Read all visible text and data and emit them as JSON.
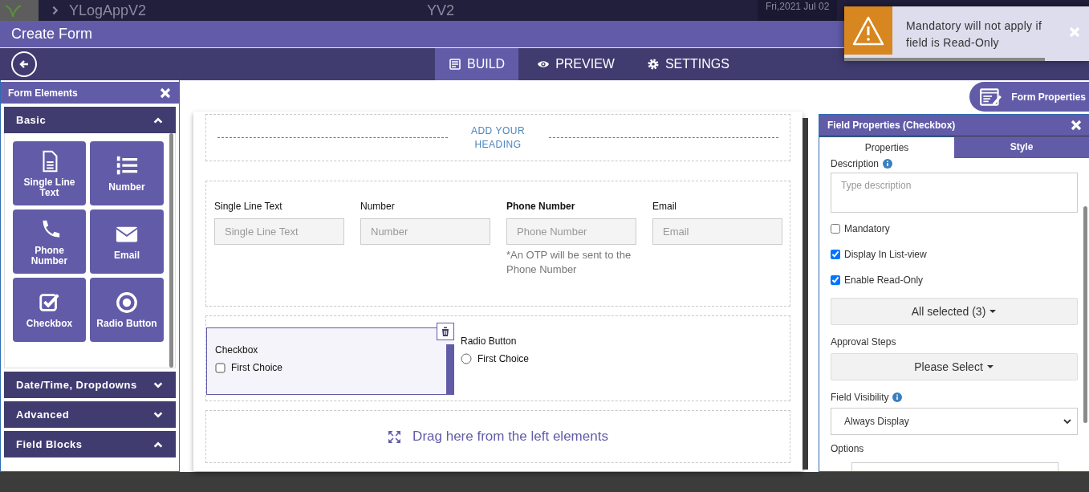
{
  "top_bar": {
    "app_name": "YLogAppV2",
    "center_label": "YV2",
    "date": "Fri,2021 Jul 02"
  },
  "page_title": "Create Form",
  "tabs": [
    {
      "label": "BUILD",
      "kind": "build",
      "selected": true
    },
    {
      "label": "PREVIEW",
      "kind": "preview",
      "selected": false
    },
    {
      "label": "SETTINGS",
      "kind": "settings",
      "selected": false
    }
  ],
  "form_elements": {
    "title": "Form Elements",
    "sections": [
      {
        "label": "Basic",
        "expanded": true,
        "items": [
          {
            "label": "Single Line Text",
            "kind": "text"
          },
          {
            "label": "Number",
            "kind": "number"
          },
          {
            "label": "Phone Number",
            "kind": "phone"
          },
          {
            "label": "Email",
            "kind": "email"
          },
          {
            "label": "Checkbox",
            "kind": "checkbox"
          },
          {
            "label": "Radio Button",
            "kind": "radio"
          }
        ]
      },
      {
        "label": "Date/Time,  Dropdowns",
        "expanded": false
      },
      {
        "label": "Advanced",
        "expanded": false
      },
      {
        "label": "Field  Blocks",
        "expanded": true
      }
    ]
  },
  "form_properties_button": "Form Properties",
  "canvas": {
    "heading": "ADD YOUR HEADING",
    "fields": [
      {
        "label": "Single Line Text",
        "placeholder": "Single Line Text",
        "bold": false
      },
      {
        "label": "Number",
        "placeholder": "Number",
        "bold": false
      },
      {
        "label": "Phone Number",
        "placeholder": "Phone Number",
        "bold": true,
        "note": "*An OTP will be sent to the Phone Number"
      },
      {
        "label": "Email",
        "placeholder": "Email",
        "bold": false
      }
    ],
    "choice_fields": [
      {
        "label": "Checkbox",
        "kind": "checkbox",
        "choice": "First Choice",
        "selected": true
      },
      {
        "label": "Radio Button",
        "kind": "radio",
        "choice": "First Choice",
        "selected": false
      }
    ],
    "drop_hint": "Drag here from the left elements"
  },
  "field_properties": {
    "title": "Field Properties (Checkbox)",
    "tabs": [
      {
        "label": "Properties",
        "selected": true
      },
      {
        "label": "Style",
        "selected": false
      }
    ],
    "description_label": "Description",
    "description_placeholder": "Type description",
    "checkboxes": [
      {
        "label": "Mandatory",
        "checked": false
      },
      {
        "label": "Display In List-view",
        "checked": true
      },
      {
        "label": "Enable Read-Only",
        "checked": true
      }
    ],
    "roles_select": "All selected (3)",
    "approval_label": "Approval Steps",
    "approval_select": "Please Select",
    "visibility_label": "Field Visibility",
    "visibility_value": "Always Display",
    "options_label": "Options"
  },
  "toast": {
    "message": "Mandatory will not apply if field is Read-Only",
    "level": 0.82
  }
}
